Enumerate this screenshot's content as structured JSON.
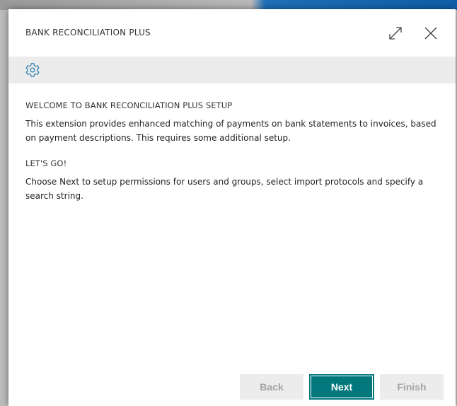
{
  "dialog": {
    "title": "BANK RECONCILIATION PLUS",
    "expand_icon": "expand-icon",
    "close_icon": "close-icon"
  },
  "action_bar": {
    "settings_icon": "gear-icon"
  },
  "content": {
    "welcome_heading": "WELCOME TO BANK RECONCILIATION PLUS SETUP",
    "welcome_text": "This extension provides enhanced matching of payments on bank statements to invoices, based on payment descriptions. This requires some additional setup.",
    "letsgo_heading": "LET'S GO!",
    "letsgo_text": "Choose Next to setup permissions for users and groups, select import protocols and specify a search string."
  },
  "footer": {
    "back_label": "Back",
    "next_label": "Next",
    "finish_label": "Finish"
  },
  "colors": {
    "accent": "#03787c",
    "action_bar": "#ececec",
    "disabled_text": "#a4a4a4"
  }
}
